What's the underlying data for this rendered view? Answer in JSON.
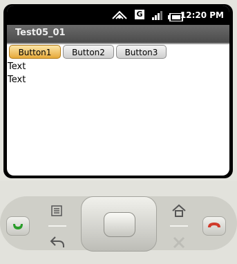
{
  "status_bar": {
    "time": "12:20 PM",
    "network_label": "G",
    "icons": [
      "notification-icon",
      "network-g-icon",
      "signal-icon",
      "battery-icon"
    ]
  },
  "app": {
    "title": "Test05_01",
    "buttons": [
      {
        "label": "Button1",
        "focused": true
      },
      {
        "label": "Button2",
        "focused": false
      },
      {
        "label": "Button3",
        "focused": false
      }
    ],
    "text_lines": [
      "Text",
      "Text"
    ]
  },
  "hardware": {
    "keys": [
      "call-icon",
      "menu-icon",
      "back-icon",
      "dpad-center",
      "home-icon",
      "search-icon",
      "end-call-icon"
    ]
  },
  "colors": {
    "focus_button": "#e6a93a",
    "call_green": "#2a9d2a",
    "end_red": "#d03a2a"
  }
}
